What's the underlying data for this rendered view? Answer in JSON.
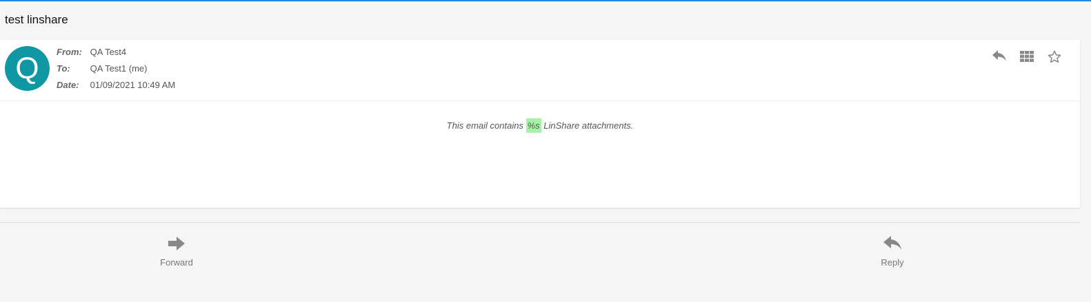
{
  "subject": "test linshare",
  "sender": {
    "avatar_letter": "Q",
    "avatar_color": "#0f97a3"
  },
  "headers": {
    "from_label": "From:",
    "from_value": "QA Test4",
    "to_label": "To:",
    "to_value": "QA Test1 (me)",
    "date_label": "Date:",
    "date_value": "01/09/2021 10:49 AM"
  },
  "actions": {
    "reply_icon": "reply-icon",
    "apps_icon": "grid-icon",
    "star_icon": "star-outline-icon"
  },
  "body": {
    "text_before": "This email contains ",
    "highlight": "%s",
    "text_after": " LinShare attachments.",
    "highlight_color": "#a6f2a6"
  },
  "footer": {
    "forward_label": "Forward",
    "reply_label": "Reply"
  },
  "colors": {
    "accent_line": "#1e88e5",
    "icon": "#888888"
  }
}
